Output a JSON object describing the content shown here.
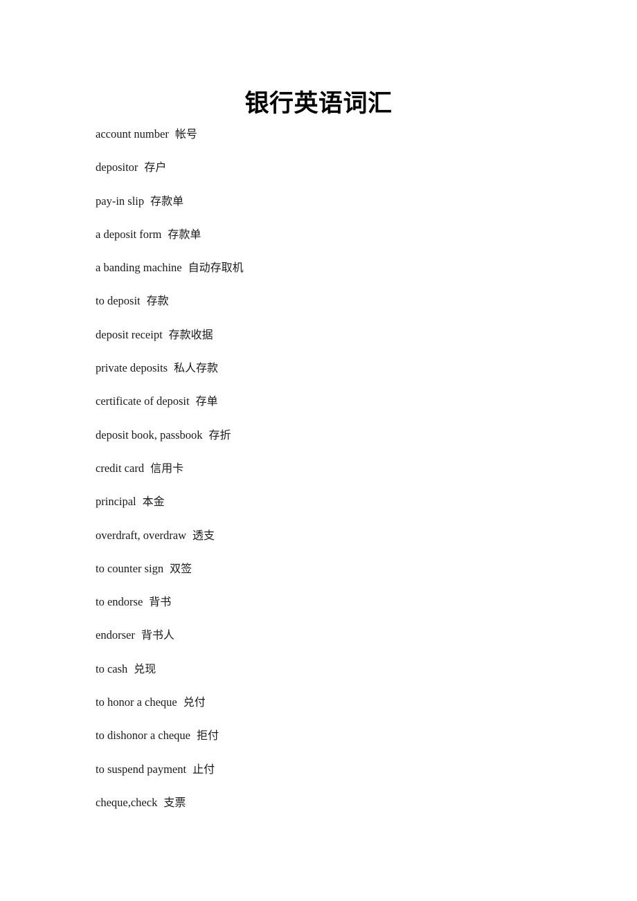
{
  "document": {
    "title": "银行英语词汇",
    "entries": [
      {
        "en": "account number",
        "zh": "帐号"
      },
      {
        "en": "depositor",
        "zh": "存户"
      },
      {
        "en": "pay-in slip",
        "zh": "存款单"
      },
      {
        "en": "a deposit form",
        "zh": "存款单"
      },
      {
        "en": "a banding machine",
        "zh": "自动存取机"
      },
      {
        "en": "to deposit",
        "zh": "存款"
      },
      {
        "en": "deposit receipt",
        "zh": "存款收据"
      },
      {
        "en": "private deposits",
        "zh": "私人存款"
      },
      {
        "en": "certificate of deposit",
        "zh": "存单"
      },
      {
        "en": "deposit book, passbook",
        "zh": "存折"
      },
      {
        "en": "credit card",
        "zh": "信用卡"
      },
      {
        "en": "principal",
        "zh": "本金"
      },
      {
        "en": "overdraft, overdraw",
        "zh": "透支"
      },
      {
        "en": "to counter sign",
        "zh": "双签"
      },
      {
        "en": "to endorse",
        "zh": "背书"
      },
      {
        "en": "endorser",
        "zh": "背书人"
      },
      {
        "en": "to cash",
        "zh": "兑现"
      },
      {
        "en": "to honor a cheque",
        "zh": "兑付"
      },
      {
        "en": "to dishonor a cheque",
        "zh": "拒付"
      },
      {
        "en": "to suspend payment",
        "zh": "止付"
      },
      {
        "en": "cheque,check",
        "zh": "支票"
      }
    ]
  }
}
